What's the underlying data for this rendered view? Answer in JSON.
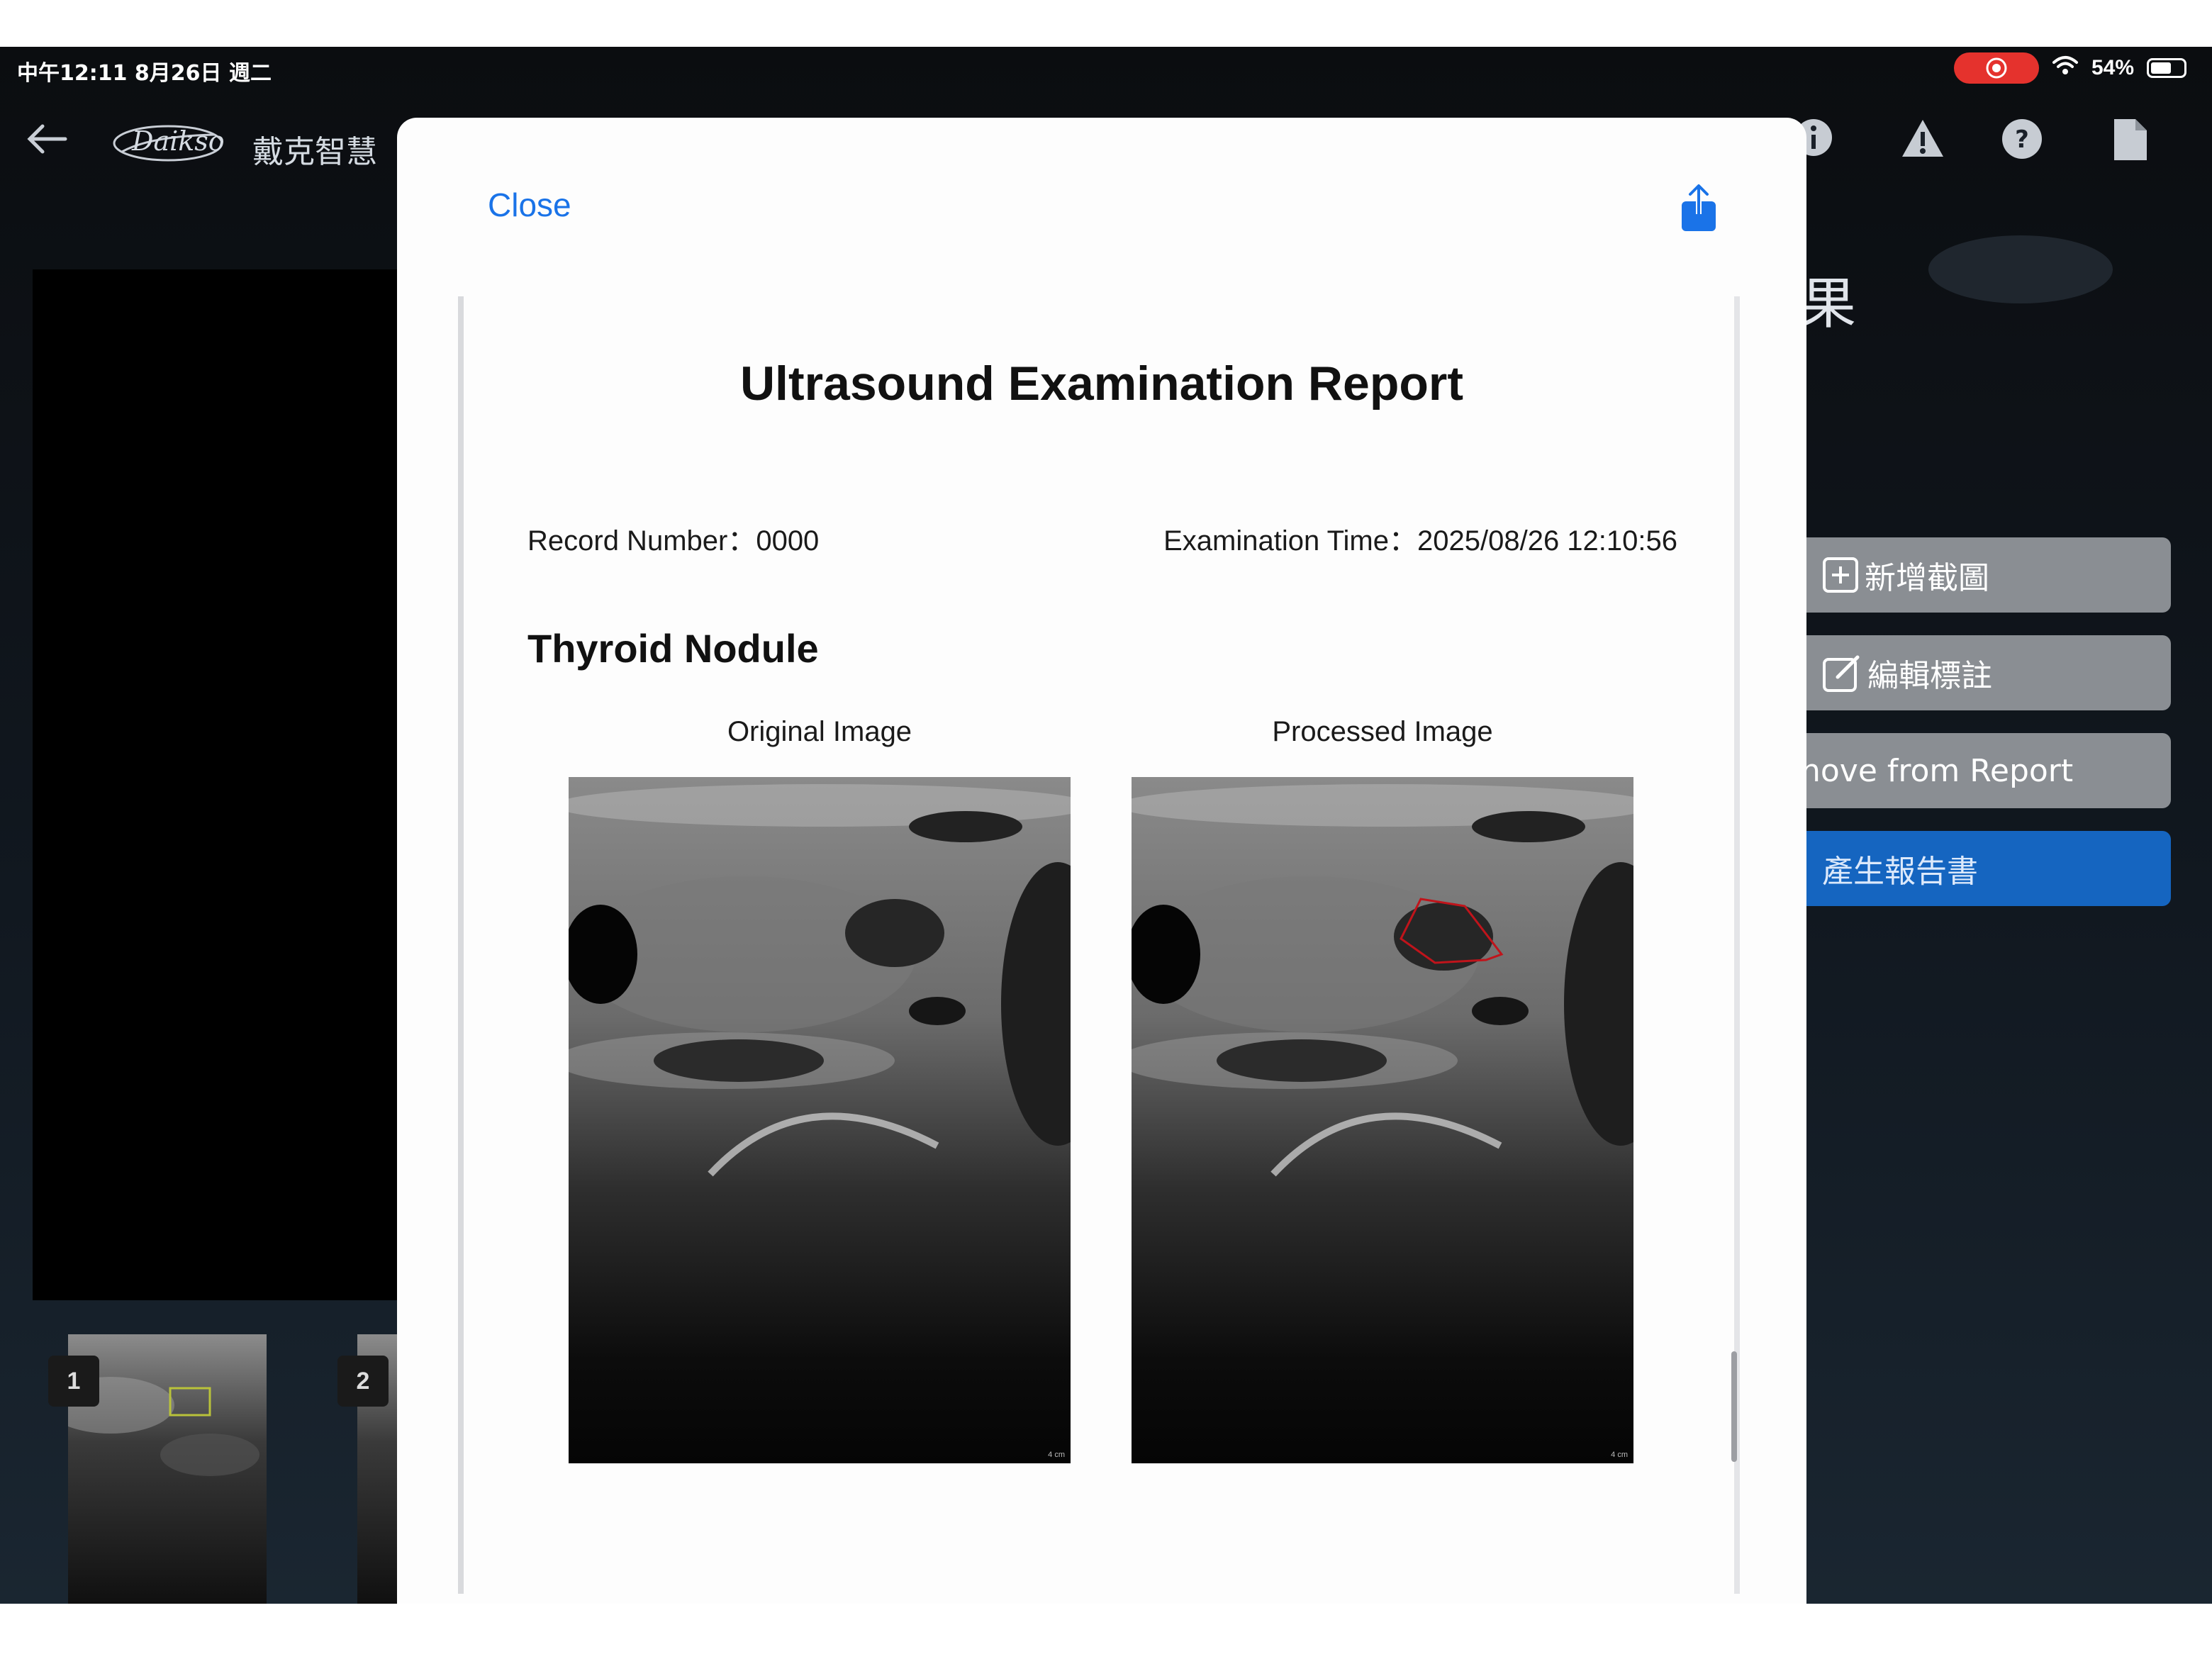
{
  "status_bar": {
    "time": "中午12:11 8月26日 週二",
    "battery": "54%"
  },
  "app_bar": {
    "brand_name": "戴克智慧"
  },
  "side_panel": {
    "title": "果",
    "buttons": [
      {
        "label": "新增截圖"
      },
      {
        "label": "編輯標註"
      },
      {
        "label": "nove from Report"
      },
      {
        "label": "產生報告書"
      }
    ]
  },
  "thumbnails": [
    {
      "number": "1"
    },
    {
      "number": "2"
    }
  ],
  "modal": {
    "close_label": "Close",
    "report": {
      "title": "Ultrasound Examination Report",
      "record_number": "Record Number：0000",
      "examination_time": "Examination Time：2025/08/26 12:10:56",
      "section_title": "Thyroid Nodule",
      "original_caption": "Original Image",
      "processed_caption": "Processed Image",
      "image_depth": "4 cm"
    }
  },
  "colors": {
    "accent": "#1a73e8",
    "primary_button": "#1565c0",
    "record_indicator": "#e5322d",
    "annotation": "#c0141b"
  }
}
